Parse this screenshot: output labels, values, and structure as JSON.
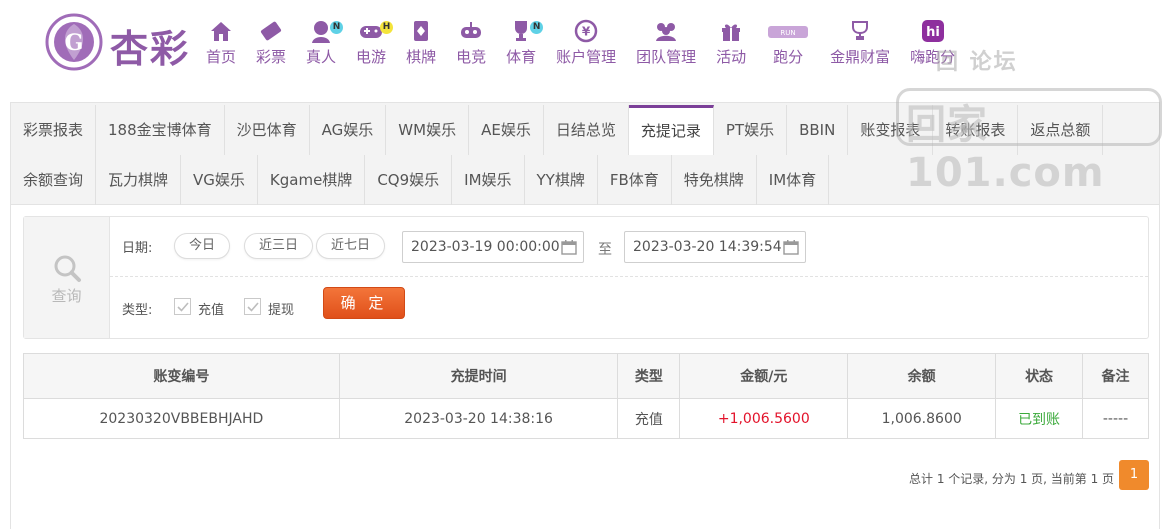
{
  "header": {
    "logo_text": "杏彩",
    "nav": [
      {
        "label": "首页",
        "icon": "home-icon"
      },
      {
        "label": "彩票",
        "icon": "ticket-icon"
      },
      {
        "label": "真人",
        "icon": "dealer-icon",
        "badge": "N"
      },
      {
        "label": "电游",
        "icon": "gamepad-icon",
        "badge": "H"
      },
      {
        "label": "棋牌",
        "icon": "cards-icon"
      },
      {
        "label": "电竞",
        "icon": "controller-icon"
      },
      {
        "label": "体育",
        "icon": "trophy-icon",
        "badge": "N"
      },
      {
        "label": "账户管理",
        "icon": "coin-icon"
      },
      {
        "label": "团队管理",
        "icon": "team-icon"
      },
      {
        "label": "活动",
        "icon": "gift-icon"
      },
      {
        "label": "跑分",
        "icon": "run-icon"
      },
      {
        "label": "金鼎财富",
        "icon": "trophy-cup-icon"
      },
      {
        "label": "嗨跑分",
        "icon": "hi-icon"
      }
    ]
  },
  "watermark": {
    "top": "回   论坛",
    "main": "回家101.com"
  },
  "tabs": {
    "row1": [
      "彩票报表",
      "188金宝博体育",
      "沙巴体育",
      "AG娱乐",
      "WM娱乐",
      "AE娱乐",
      "日结总览",
      "充提记录",
      "PT娱乐",
      "BBIN",
      "账变报表",
      "转账报表",
      "返点总额"
    ],
    "row2": [
      "余额查询",
      "瓦力棋牌",
      "VG娱乐",
      "Kgame棋牌",
      "CQ9娱乐",
      "IM娱乐",
      "YY棋牌",
      "FB体育",
      "特免棋牌",
      "IM体育"
    ],
    "active": "充提记录"
  },
  "query": {
    "side_label": "查询",
    "date_label": "日期:",
    "quick": [
      "今日",
      "近三日",
      "近七日"
    ],
    "start": "2023-03-19 00:00:00",
    "to": "至",
    "end": "2023-03-20 14:39:54",
    "type_label": "类型:",
    "types": [
      {
        "label": "充值",
        "checked": true
      },
      {
        "label": "提现",
        "checked": true
      }
    ],
    "confirm": "确 定"
  },
  "table": {
    "headers": [
      "账变编号",
      "充提时间",
      "类型",
      "金额/元",
      "余额",
      "状态",
      "备注"
    ],
    "rows": [
      [
        "20230320VBBEBHJAHD",
        "2023-03-20 14:38:16",
        "充值",
        "+1,006.5600",
        "1,006.8600",
        "已到账",
        "-----"
      ]
    ]
  },
  "pager": {
    "summary": "总计 1 个记录, 分为 1 页, 当前第 1 页",
    "current": "1"
  },
  "colors": {
    "brand": "#8e5aa6",
    "active_tab": "#7b3f98",
    "confirm": "#e0501a",
    "amount_positive": "#e3132b",
    "status_ok": "#3caa3c",
    "pager": "#f08a2c"
  }
}
